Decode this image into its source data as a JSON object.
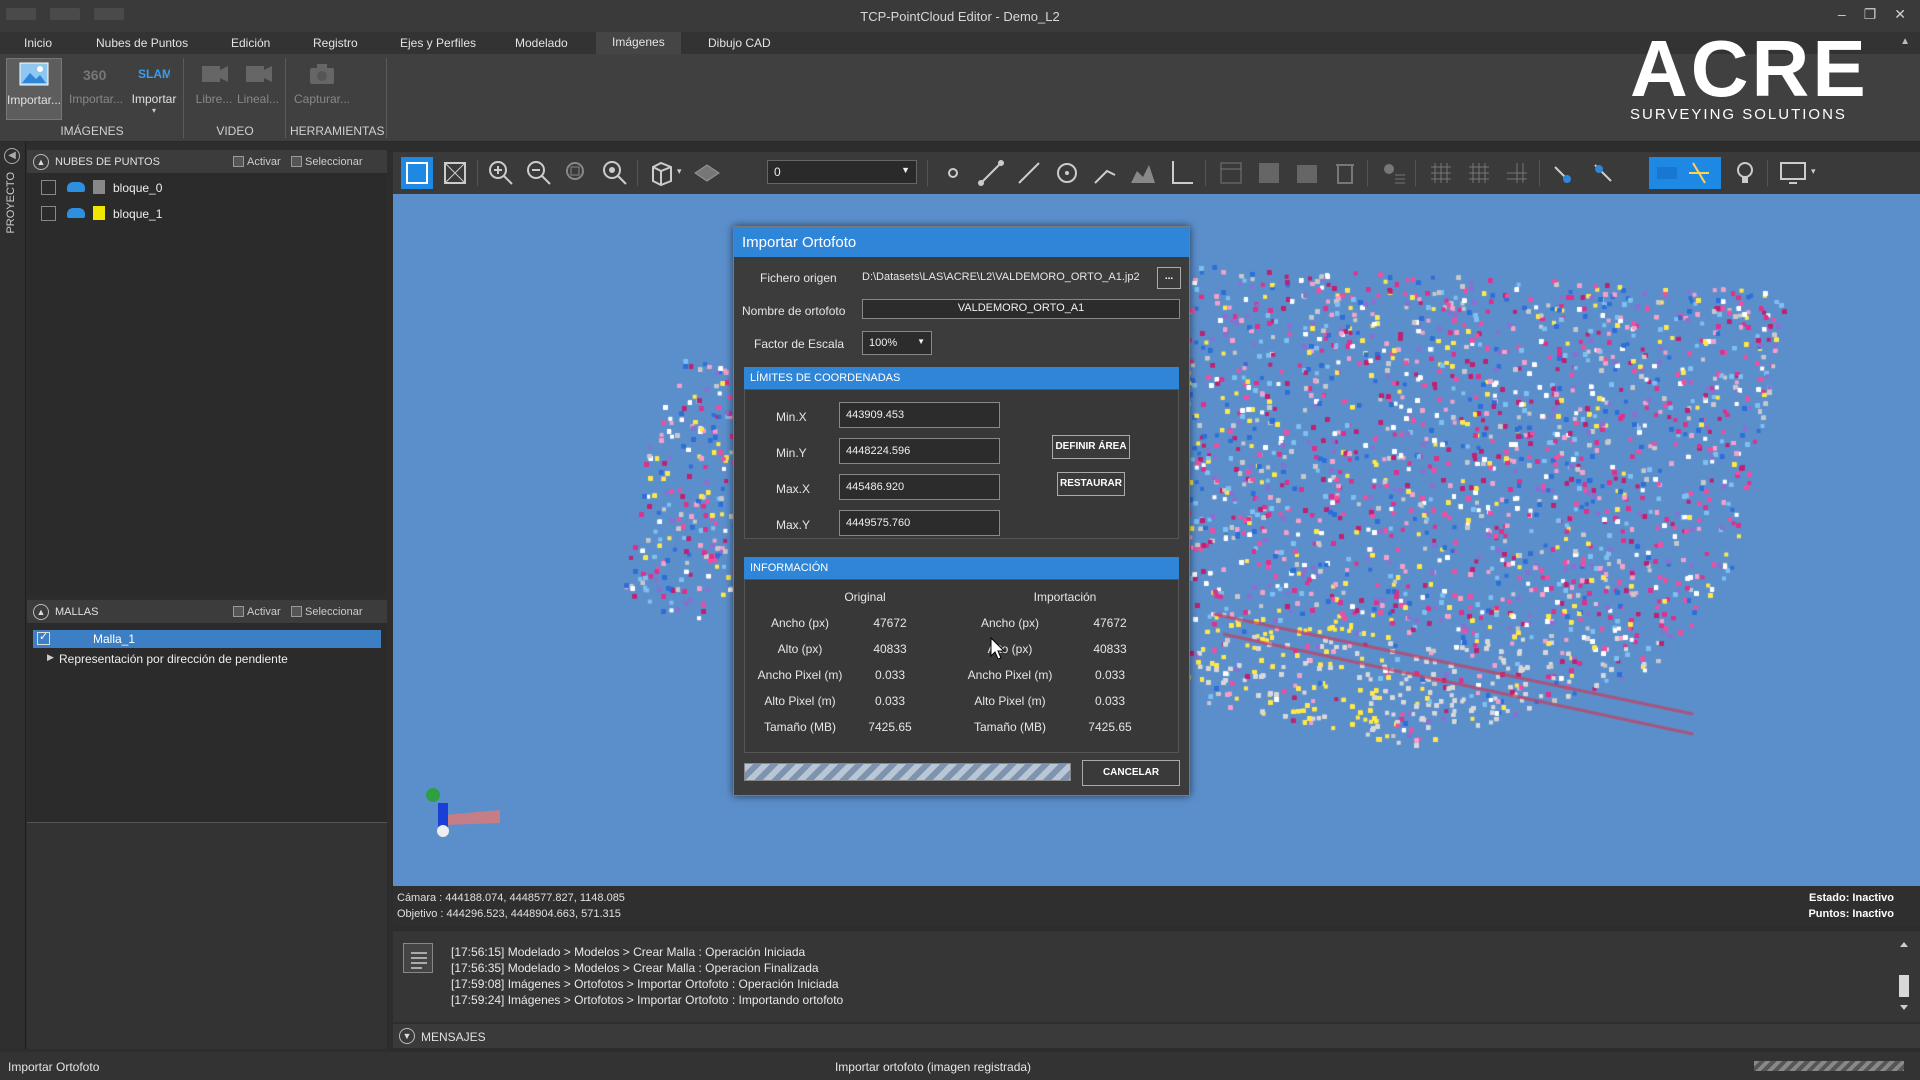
{
  "window": {
    "title": "TCP-PointCloud Editor - Demo_L2",
    "minimize": "–",
    "restore": "❐",
    "close": "✕"
  },
  "menu": [
    "Inicio",
    "Nubes de Puntos",
    "Edición",
    "Registro",
    "Ejes y Perfiles",
    "Modelado",
    "Imágenes",
    "Dibujo CAD"
  ],
  "menu_active": "Imágenes",
  "ribbon": {
    "buttons": [
      {
        "label": "Importar...",
        "icon": "import-image-icon",
        "state": "active"
      },
      {
        "label": "Importar...",
        "icon": "import-360-icon",
        "state": "disabled"
      },
      {
        "label": "Importar",
        "icon": "slam-icon",
        "state": "normal",
        "badge": "SLAM"
      },
      {
        "label": "Libre...",
        "icon": "free-video-icon",
        "state": "disabled"
      },
      {
        "label": "Lineal...",
        "icon": "linear-video-icon",
        "state": "disabled"
      },
      {
        "label": "Capturar...",
        "icon": "camera-icon",
        "state": "disabled"
      }
    ],
    "groups": [
      "IMÁGENES",
      "VIDEO",
      "HERRAMIENTAS"
    ],
    "badge_360": "360"
  },
  "logo": {
    "name": "ACRE",
    "tagline": "SURVEYING SOLUTIONS"
  },
  "side_strip_label": "PROYECTO",
  "point_clouds": {
    "title": "NUBES DE PUNTOS",
    "activate": "Activar",
    "select": "Seleccionar",
    "items": [
      {
        "label": "bloque_0",
        "swatch": "#888888"
      },
      {
        "label": "bloque_1",
        "swatch": "#f2e600"
      }
    ]
  },
  "meshes": {
    "title": "MALLAS",
    "activate": "Activar",
    "select": "Seleccionar",
    "items": [
      {
        "label": "Malla_1",
        "selected": true
      },
      {
        "label": "Representación por dirección de pendiente",
        "expandable": true
      }
    ]
  },
  "toolbar": {
    "layer_value": "0"
  },
  "dialog": {
    "title": "Importar Ortofoto",
    "source_label": "Fichero origen",
    "source_value": "D:\\Datasets\\LAS\\ACRE\\L2\\VALDEMORO_ORTO_A1.jp2",
    "browse": "...",
    "name_label": "Nombre de ortofoto",
    "name_value": "VALDEMORO_ORTO_A1",
    "scale_label": "Factor de Escala",
    "scale_value": "100%",
    "coords_title": "LÍMITES DE COORDENADAS",
    "coords": [
      {
        "label": "Min.X",
        "value": "443909.453"
      },
      {
        "label": "Min.Y",
        "value": "4448224.596"
      },
      {
        "label": "Max.X",
        "value": "445486.920"
      },
      {
        "label": "Max.Y",
        "value": "4449575.760"
      }
    ],
    "define_area": "DEFINIR ÁREA",
    "restore": "RESTAURAR",
    "info_title": "INFORMACIÓN",
    "col_original": "Original",
    "col_import": "Importación",
    "info_rows": [
      {
        "label": "Ancho (px)",
        "original": "47672",
        "import_label": "Ancho (px)",
        "import": "47672"
      },
      {
        "label": "Alto (px)",
        "original": "40833",
        "import_label": "Alto (px)",
        "import": "40833"
      },
      {
        "label": "Ancho Pixel (m)",
        "original": "0.033",
        "import_label": "Ancho Pixel (m)",
        "import": "0.033"
      },
      {
        "label": "Alto Pixel (m)",
        "original": "0.033",
        "import_label": "Alto Pixel (m)",
        "import": "0.033"
      },
      {
        "label": "Tamaño (MB)",
        "original": "7425.65",
        "import_label": "Tamaño (MB)",
        "import": "7425.65"
      }
    ],
    "cancel": "CANCELAR"
  },
  "viewport_status": {
    "camera": "Cámara : 444188.074, 4448577.827, 1148.085",
    "target": "Objetivo : 444296.523, 4448904.663, 571.315",
    "state": "Estado: Inactivo",
    "points": "Puntos: Inactivo"
  },
  "messages": {
    "title": "MENSAJES",
    "lines": [
      "[17:56:15] Modelado > Modelos > Crear Malla : Operación Iniciada",
      "[17:56:35] Modelado > Modelos > Crear Malla : Operacion Finalizada",
      "[17:59:08] Imágenes > Ortofotos > Importar Ortofoto : Operación Iniciada",
      "[17:59:24] Imágenes > Ortofotos > Importar Ortofoto : Importando ortofoto"
    ]
  },
  "statusbar": {
    "left": "Importar Ortofoto",
    "center": "Importar ortofoto (imagen registrada)"
  },
  "colors": {
    "accent": "#2f86d8",
    "viewport_bg": "#5b8fcc",
    "toolbar_active": "#1e88e5"
  }
}
